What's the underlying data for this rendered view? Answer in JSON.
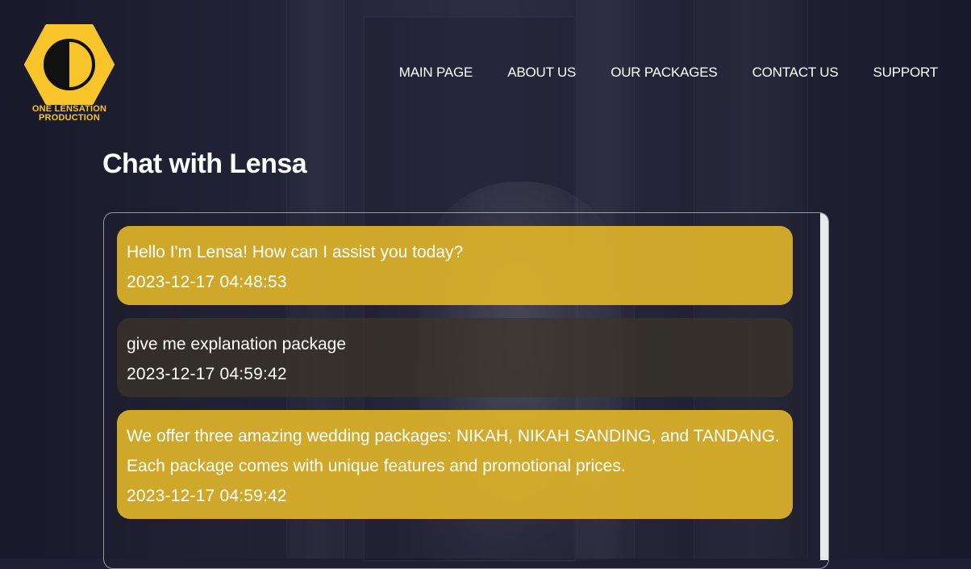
{
  "brand": {
    "name_line1": "ONE LENSATION",
    "name_line2": "PRODUCTION",
    "logo_icon": "half-circle-hexagon-icon",
    "accent_color": "#f7c52b"
  },
  "nav": {
    "items": [
      {
        "label": "MAIN PAGE"
      },
      {
        "label": "ABOUT US"
      },
      {
        "label": "OUR PACKAGES"
      },
      {
        "label": "CONTACT US"
      },
      {
        "label": "SUPPORT"
      }
    ]
  },
  "page": {
    "title": "Chat with Lensa"
  },
  "chat": {
    "messages": [
      {
        "role": "bot",
        "text": "Hello I'm Lensa! How can I assist you today?",
        "time": "2023-12-17 04:48:53"
      },
      {
        "role": "user",
        "text": "give me explanation package",
        "time": "2023-12-17 04:59:42"
      },
      {
        "role": "bot",
        "text": "We offer three amazing wedding packages: NIKAH, NIKAH SANDING, and TANDANG. Each package comes with unique features and promotional prices.",
        "time": "2023-12-17 04:59:42"
      }
    ],
    "bot_bubble_color": "#deb42a",
    "user_bubble_color": "#3c3428"
  }
}
